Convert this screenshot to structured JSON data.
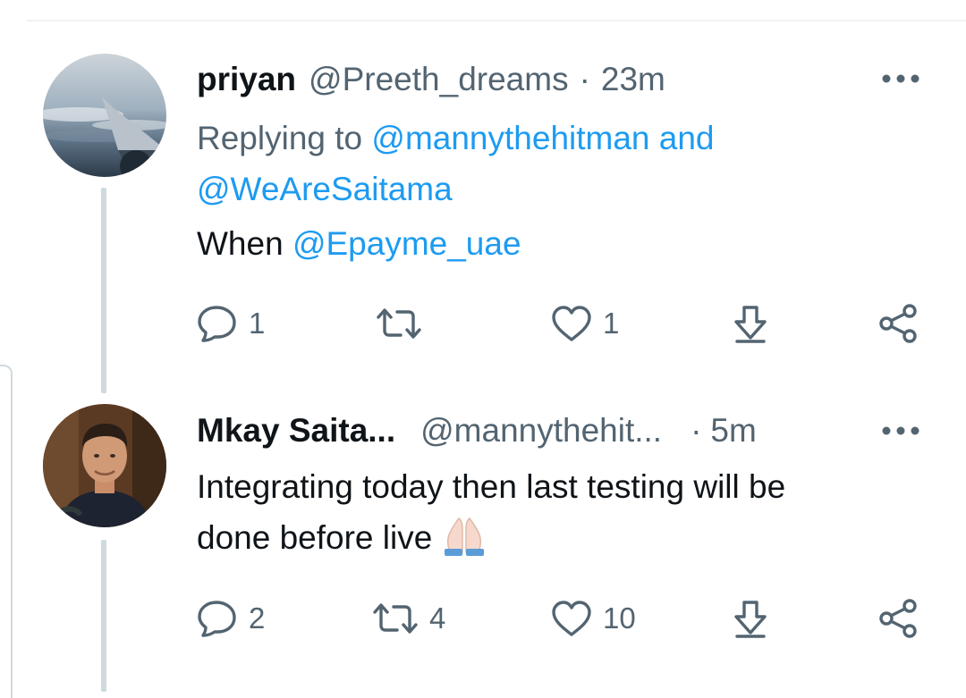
{
  "tweets": [
    {
      "name": "priyan",
      "handle": "@Preeth_dreams",
      "separator": "·",
      "time": "23m",
      "replying_prefix": "Replying to",
      "replying_to_1": "@mannythehitman",
      "replying_and": "and",
      "replying_to_2": "@WeAreSaitama",
      "body_prefix": "When",
      "body_mention": "@Epayme_uae",
      "reply_count": "1",
      "retweet_count": "",
      "like_count": "1",
      "avatar_icon": "airplane-wing-sky-avatar"
    },
    {
      "name": "Mkay Saita...",
      "handle": "@mannythehit...",
      "separator": "·",
      "time": "5m",
      "body_line_1": "Integrating today then last testing will be",
      "body_line_2": "done before live",
      "body_emoji": "folded-hands-emoji",
      "reply_count": "2",
      "retweet_count": "4",
      "like_count": "10",
      "avatar_icon": "man-portrait-avatar"
    }
  ],
  "icons": {
    "more": "more-horizontal-icon",
    "reply": "reply-bubble-icon",
    "retweet": "retweet-icon",
    "like": "heart-icon",
    "download": "download-icon",
    "share": "share-icon"
  },
  "colors": {
    "link": "#1d9bf0",
    "secondary_text": "#536471",
    "primary_text": "#0f1419",
    "thread_line": "#cfd9de"
  }
}
